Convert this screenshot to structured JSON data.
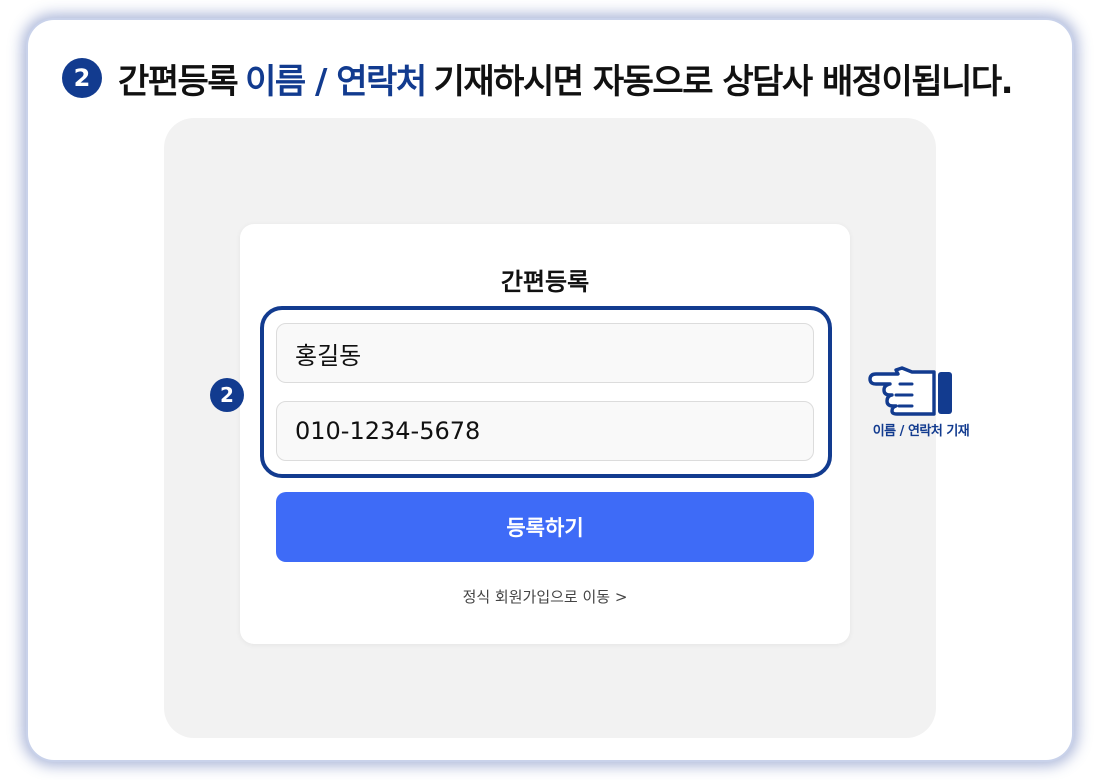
{
  "headline": {
    "step_number": "2",
    "prefix": "간편등록",
    "highlight": "이름 / 연락처",
    "suffix": "기재하시면 자동으로 상담사 배정이됩니다."
  },
  "form": {
    "title": "간편등록",
    "name_value": "홍길동",
    "phone_value": "010-1234-5678",
    "submit_label": "등록하기",
    "member_link": "정식 회원가입으로 이동 >"
  },
  "annotation": {
    "step_number": "2",
    "hand_icon": "pointing-hand-icon",
    "caption": "이름 / 연락처 기재"
  },
  "colors": {
    "navy": "#123b8f",
    "button_blue": "#3e6bf7",
    "panel_gray": "#f2f2f2"
  }
}
